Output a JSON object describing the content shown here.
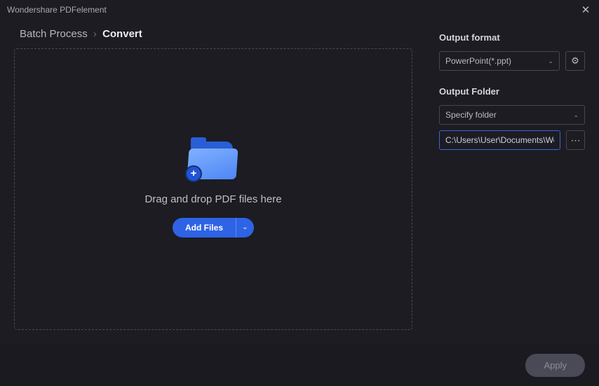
{
  "titlebar": {
    "title": "Wondershare PDFelement"
  },
  "breadcrumb": {
    "root": "Batch Process",
    "current": "Convert",
    "sep": "›"
  },
  "dropzone": {
    "label": "Drag and drop PDF files here",
    "add_files": "Add Files"
  },
  "sidebar": {
    "output_format_label": "Output format",
    "output_format_value": "PowerPoint(*.ppt)",
    "output_folder_label": "Output Folder",
    "specify_folder": "Specify folder",
    "folder_path": "C:\\Users\\User\\Documents\\Wondershare"
  },
  "footer": {
    "apply": "Apply"
  },
  "icons": {
    "plus": "+",
    "chevron_down": "⌄",
    "gear": "⚙",
    "ellipsis": "⋯",
    "close": "✕"
  }
}
